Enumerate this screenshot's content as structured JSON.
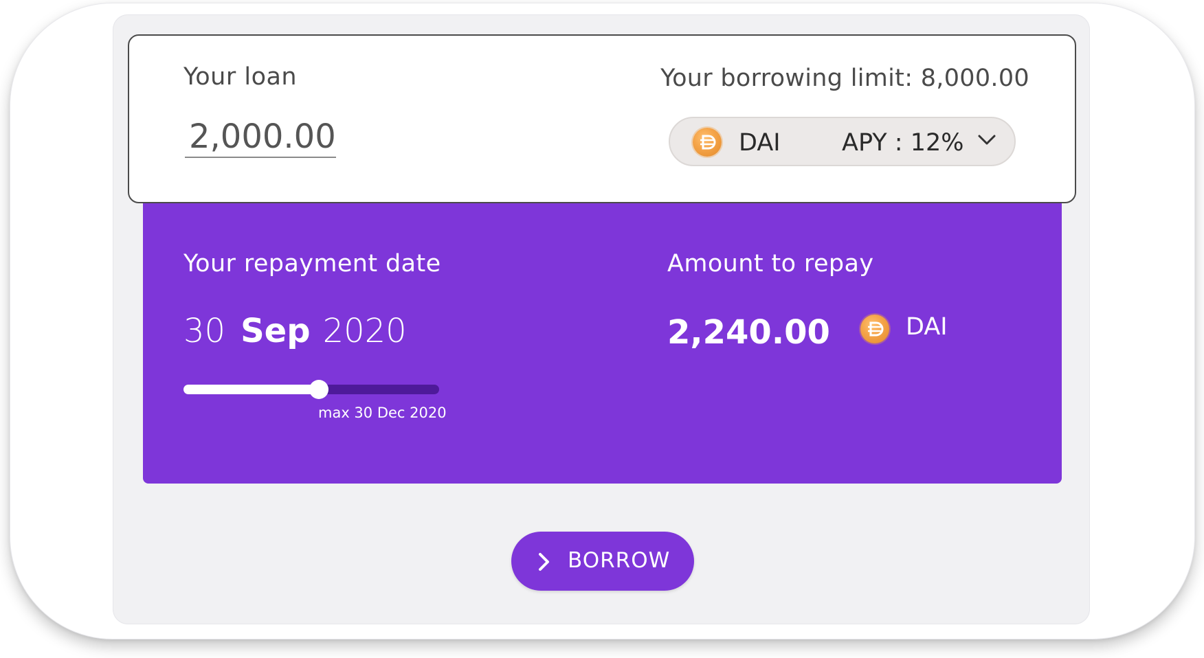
{
  "loan": {
    "label": "Your loan",
    "amount": "2,000.00"
  },
  "borrowing_limit": {
    "text": "Your borrowing limit: 8,000.00"
  },
  "token_selector": {
    "token": "DAI",
    "apy": "APY : 12%",
    "icon": "dai-coin-icon",
    "icon_color": "#f5a54a"
  },
  "repayment": {
    "date_label": "Your repayment date",
    "day": "30",
    "month": "Sep",
    "year": "2020",
    "slider_fraction": 0.53,
    "max_label": "max 30 Dec 2020"
  },
  "repay_amount": {
    "label": "Amount to repay",
    "value": "2,240.00",
    "token": "DAI"
  },
  "borrow_button": {
    "label": "BORROW",
    "icon": "chevron-right-icon"
  },
  "colors": {
    "accent": "#7e36d9",
    "slider_track": "#4e1a9a",
    "card_background": "#f1f1f3"
  }
}
